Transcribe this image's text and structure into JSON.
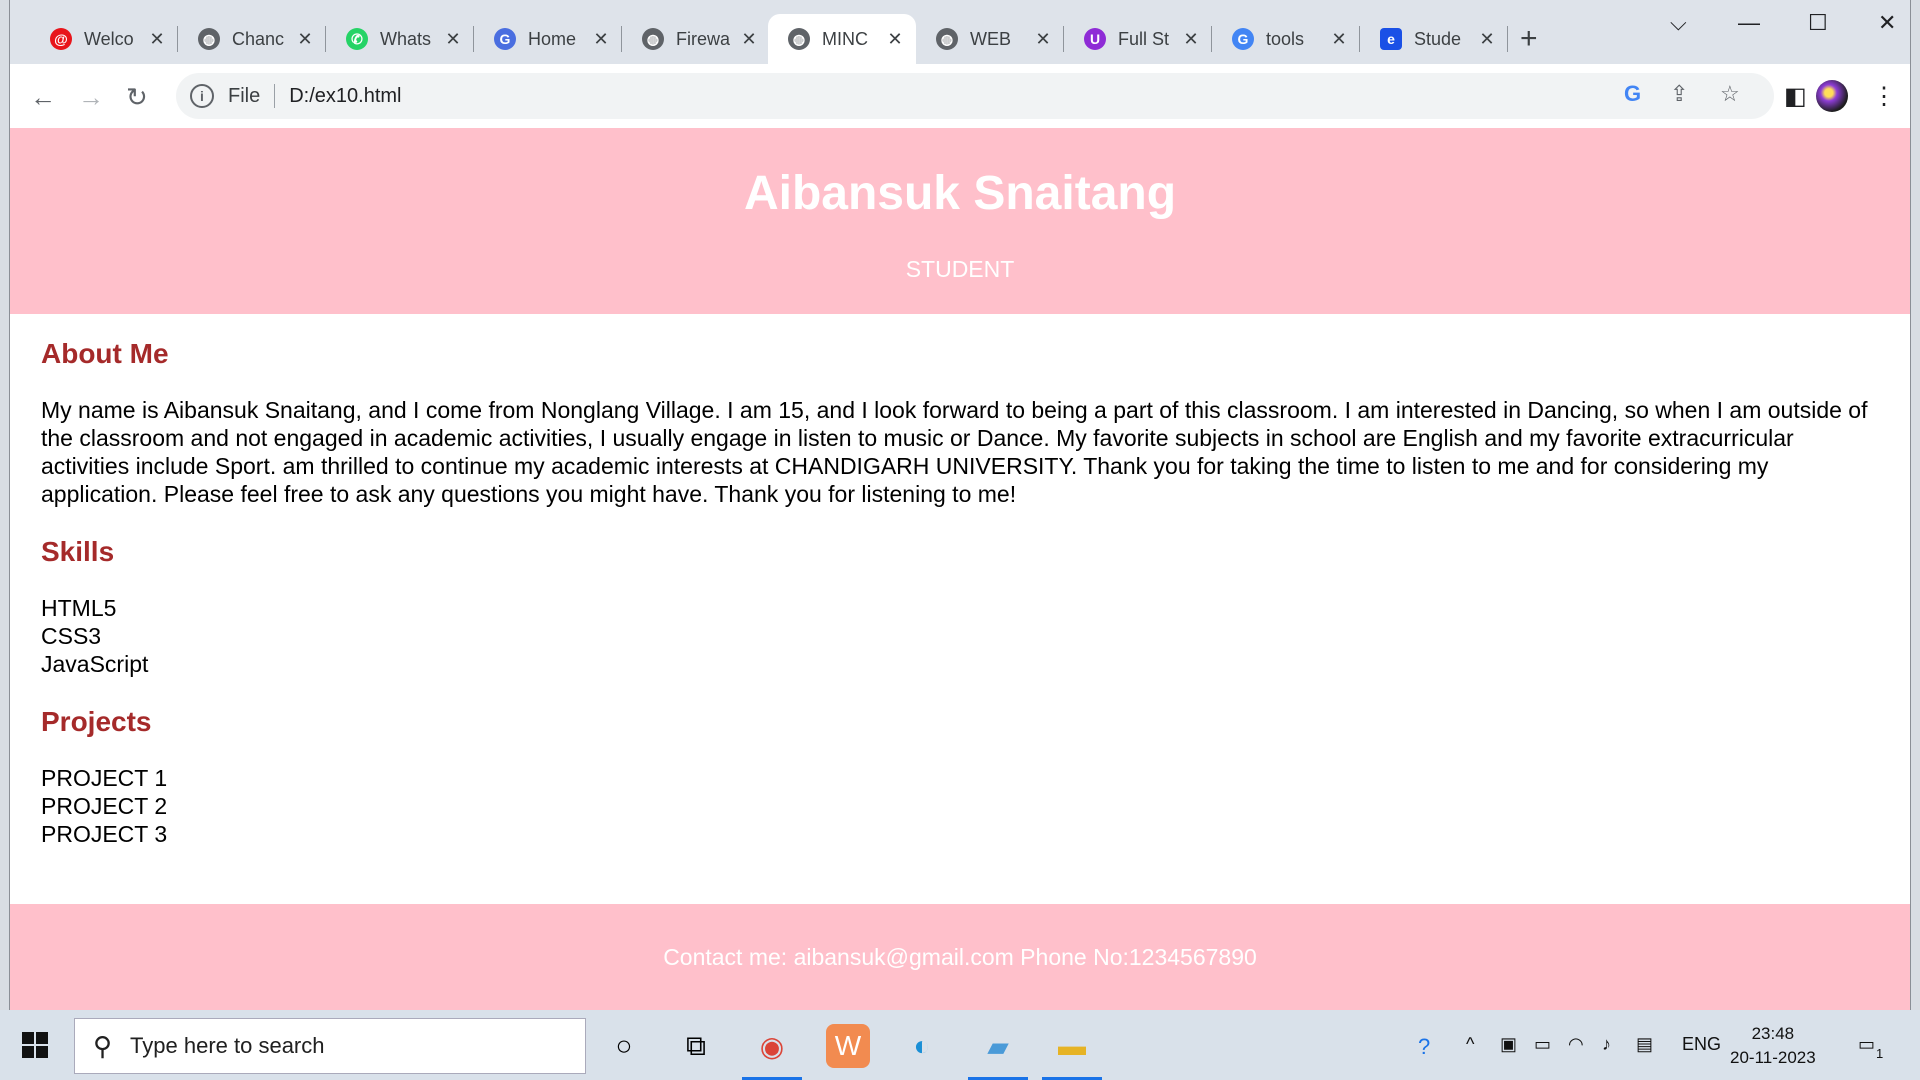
{
  "tabs": [
    {
      "label": "Welco",
      "icon": "at-sign-icon",
      "color": "#e8151b"
    },
    {
      "label": "Chanc",
      "icon": "globe-icon",
      "color": "#5f6368"
    },
    {
      "label": "Whats",
      "icon": "whatsapp-icon",
      "color": "#25d366"
    },
    {
      "label": "Home",
      "icon": "home-site-icon",
      "color": "#4a6ee0"
    },
    {
      "label": "Firewa",
      "icon": "globe-icon",
      "color": "#5f6368"
    },
    {
      "label": "MINC",
      "icon": "globe-icon",
      "color": "#5f6368"
    },
    {
      "label": "WEB",
      "icon": "globe-icon",
      "color": "#5f6368"
    },
    {
      "label": "Full St",
      "icon": "u-badge-icon",
      "color": "#8e2bd6"
    },
    {
      "label": "tools",
      "icon": "google-icon",
      "color": "#4285f4"
    },
    {
      "label": "Stude",
      "icon": "e-badge-icon",
      "color": "#1a50e6"
    }
  ],
  "address": {
    "scheme_label": "File",
    "url": "D:/ex10.html"
  },
  "resume": {
    "name": "Aibansuk Snaitang",
    "role": "STUDENT",
    "about_heading": "About Me",
    "about_text": "My name is Aibansuk Snaitang, and I come from Nonglang Village. I am 15, and I look forward to being a part of this classroom. I am interested in Dancing, so when I am outside of the classroom and not engaged in academic activities, I usually engage in listen to music or Dance. My favorite subjects in school are English and my favorite extracurricular activities include Sport. am thrilled to continue my academic interests at CHANDIGARH UNIVERSITY. Thank you for taking the time to listen to me and for considering my application. Please feel free to ask any questions you might have. Thank you for listening to me!",
    "skills_heading": "Skills",
    "skills": [
      "HTML5",
      "CSS3",
      "JavaScript"
    ],
    "projects_heading": "Projects",
    "projects": [
      "PROJECT 1",
      "PROJECT 2",
      "PROJECT 3"
    ],
    "footer": "Contact me: aibansuk@gmail.com Phone No:1234567890"
  },
  "taskbar": {
    "search_placeholder": "Type here to search",
    "language": "ENG",
    "time": "23:48",
    "date": "20-11-2023",
    "notification_count": "1"
  },
  "colors": {
    "header_bg": "#ffc0cb",
    "heading": "#a52a2a"
  }
}
